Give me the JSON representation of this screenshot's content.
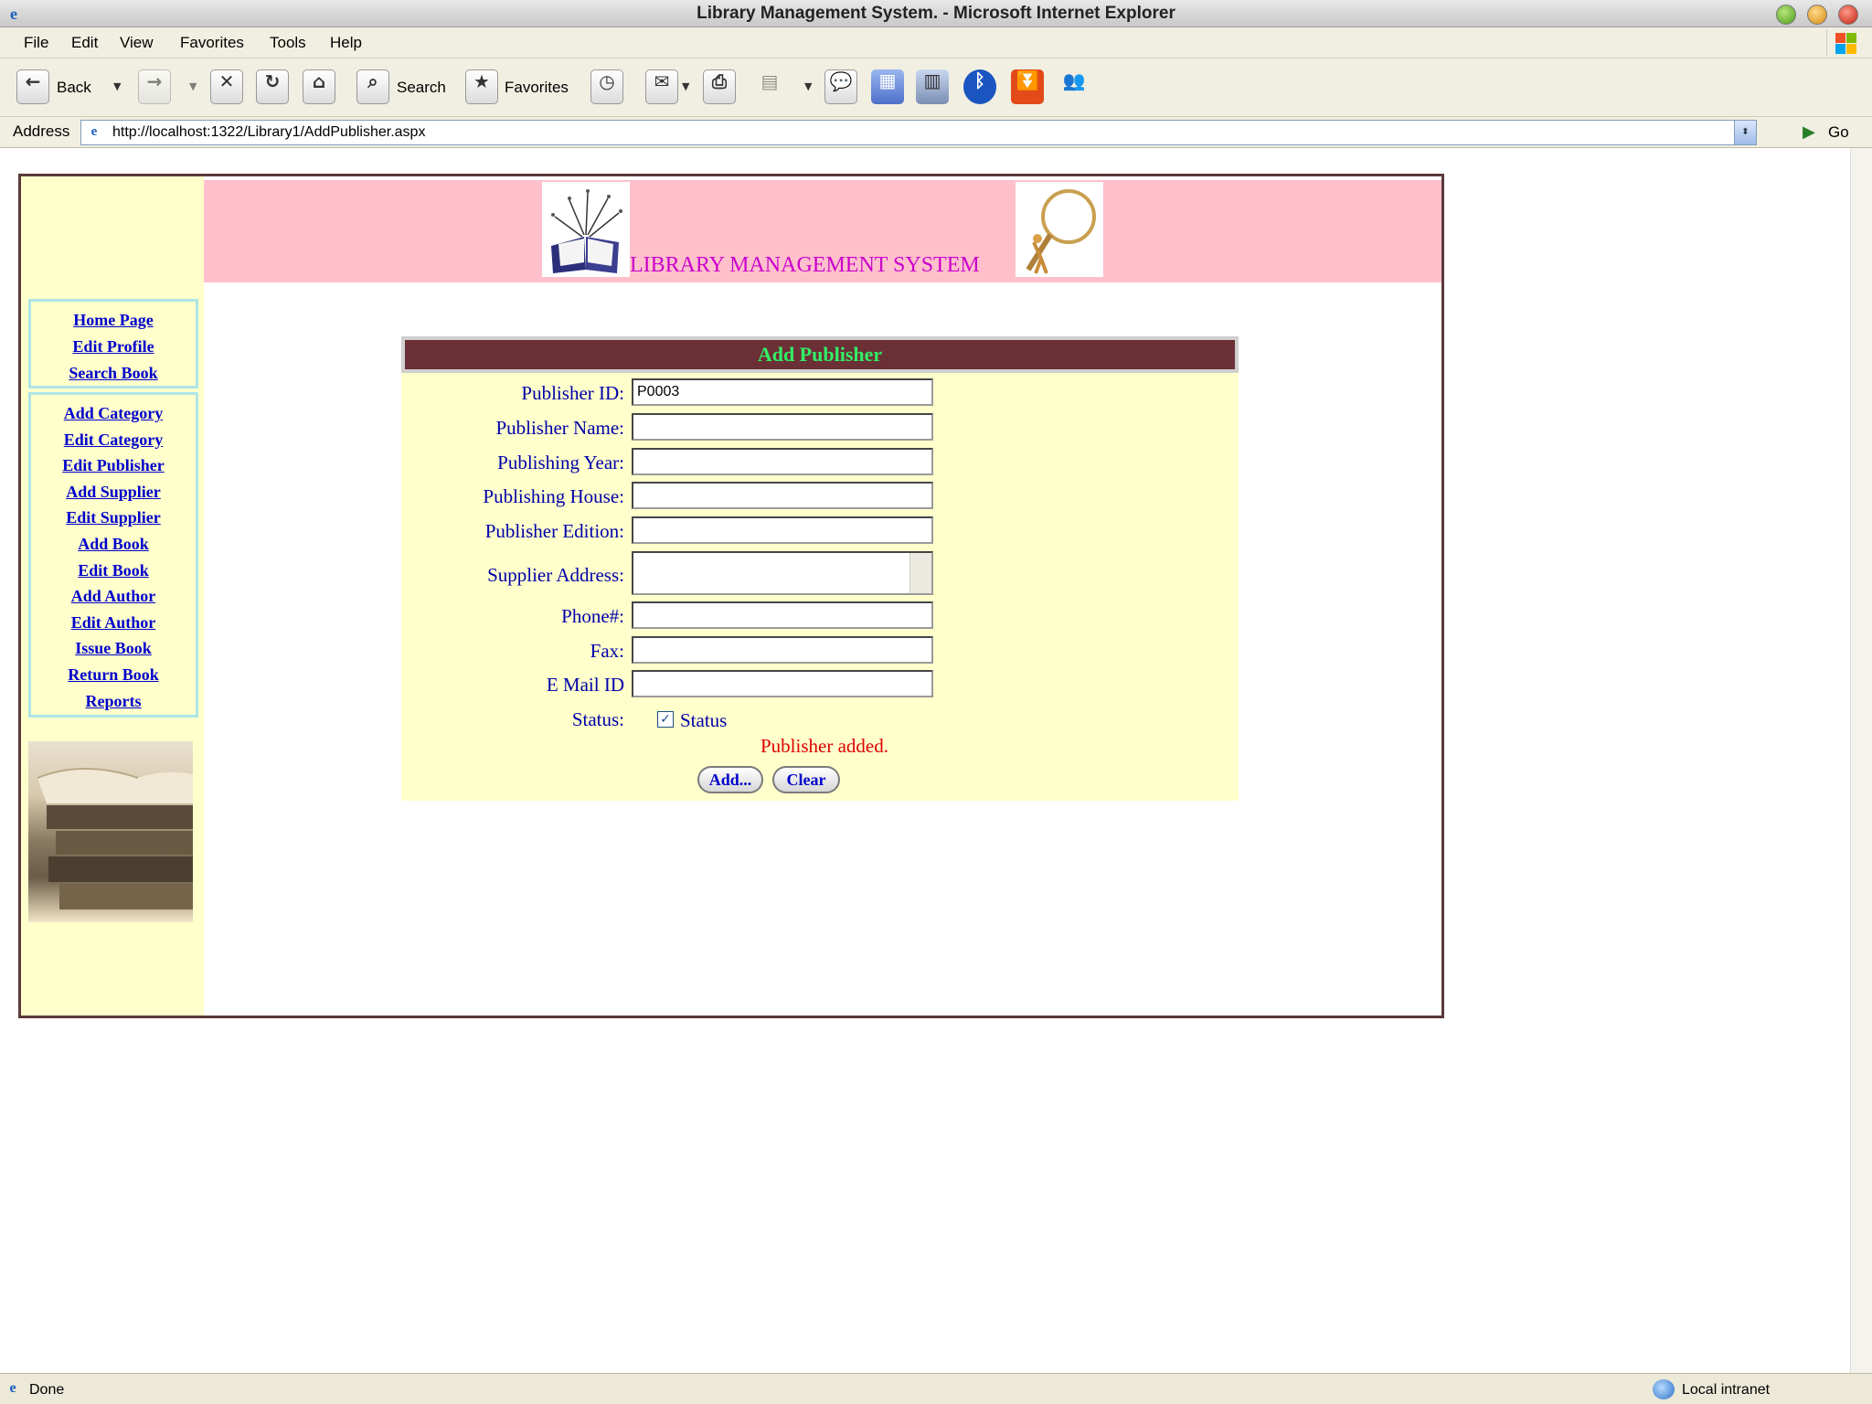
{
  "window": {
    "title": "Library Management System. - Microsoft Internet Explorer"
  },
  "menu": {
    "items": [
      "File",
      "Edit",
      "View",
      "Favorites",
      "Tools",
      "Help"
    ]
  },
  "toolbar": {
    "back_label": "Back",
    "search_label": "Search",
    "favorites_label": "Favorites"
  },
  "address": {
    "label": "Address",
    "url": "http://localhost:1322/Library1/AddPublisher.aspx",
    "go_label": "Go"
  },
  "page": {
    "banner_title": "LIBRARY MANAGEMENT SYSTEM",
    "nav_top": [
      "Home Page",
      "Edit Profile",
      "Search Book"
    ],
    "nav_admin": [
      "Add Category",
      "Edit Category",
      "Edit Publisher",
      "Add Supplier",
      "Edit Supplier",
      "Add Book",
      "Edit Book",
      "Add Author",
      "Edit Author",
      "Issue Book",
      "Return Book",
      "Reports"
    ]
  },
  "form": {
    "title": "Add Publisher",
    "fields": [
      {
        "label": "Publisher ID:",
        "value": "P0003"
      },
      {
        "label": "Publisher Name:",
        "value": ""
      },
      {
        "label": "Publishing Year:",
        "value": ""
      },
      {
        "label": "Publishing House:",
        "value": ""
      },
      {
        "label": "Publisher Edition:",
        "value": ""
      },
      {
        "label": "Supplier Address:",
        "value": ""
      },
      {
        "label": "Phone#:",
        "value": ""
      },
      {
        "label": "Fax:",
        "value": ""
      },
      {
        "label": "E Mail ID",
        "value": ""
      }
    ],
    "status_label": "Status:",
    "status_checkbox_label": "Status",
    "status_checked": true,
    "message": "Publisher added.",
    "add_button": "Add...",
    "clear_button": "Clear"
  },
  "statusbar": {
    "text": "Done",
    "zone": "Local intranet"
  },
  "colors": {
    "banner_bg": "#ffc0cb",
    "banner_title": "#cc00cc",
    "side_bg": "#ffffcc",
    "form_header_bg": "#6b2f36",
    "form_header_text": "#33ee66",
    "label_text": "#0000aa",
    "link_text": "#0000cc",
    "message_text": "#dd0000"
  }
}
